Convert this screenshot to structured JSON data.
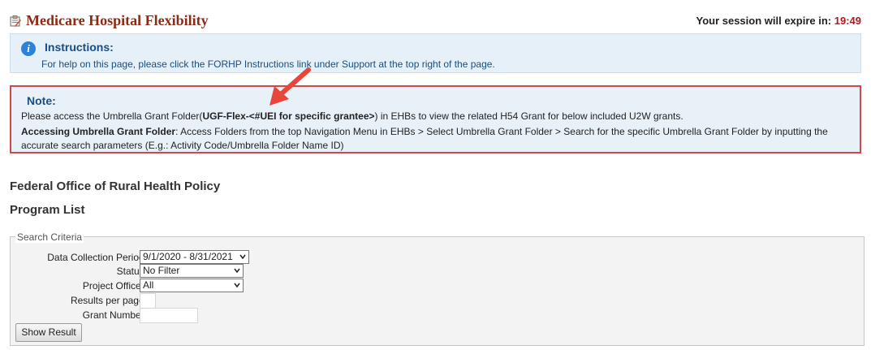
{
  "header": {
    "title": "Medicare Hospital Flexibility",
    "session_label": "Your session will expire in:",
    "session_time": "19:49"
  },
  "instructions": {
    "title": "Instructions:",
    "text": "For help on this page, please click the FORHP Instructions link under Support at the top right of the page."
  },
  "note": {
    "title": "Note:",
    "line1_prefix": "Please access the Umbrella Grant Folder(",
    "line1_bold": "UGF-Flex-<#UEI for specific grantee>",
    "line1_suffix": ") in EHBs to view the related H54 Grant for below included U2W grants.",
    "line2_bold": "Accessing Umbrella Grant Folder",
    "line2_text": ": Access Folders from the top Navigation Menu in EHBs > Select Umbrella Grant Folder > Search for the specific Umbrella Grant Folder by inputting the accurate search parameters (E.g.: Activity Code/Umbrella Folder Name ID)"
  },
  "page": {
    "org_title": "Federal Office of Rural Health Policy",
    "list_title": "Program List"
  },
  "search": {
    "legend": "Search Criteria",
    "period_label": "Data Collection Period:",
    "period_value": "9/1/2020 - 8/31/2021",
    "status_label": "Status:",
    "status_value": "No Filter",
    "officer_label": "Project Officer:",
    "officer_value": "All",
    "results_label": "Results per page:",
    "results_value": "",
    "grant_label": "Grant Number:",
    "grant_value": "",
    "button_label": "Show Result"
  },
  "colors": {
    "title": "#8b2a15",
    "session_time": "#b5161b",
    "note_border": "#d14848",
    "info_blue": "#2e82d6",
    "arrow": "#e8463a"
  },
  "icons": [
    "clipboard-icon",
    "info-icon",
    "chevron-down-icon",
    "arrow-annotation"
  ]
}
